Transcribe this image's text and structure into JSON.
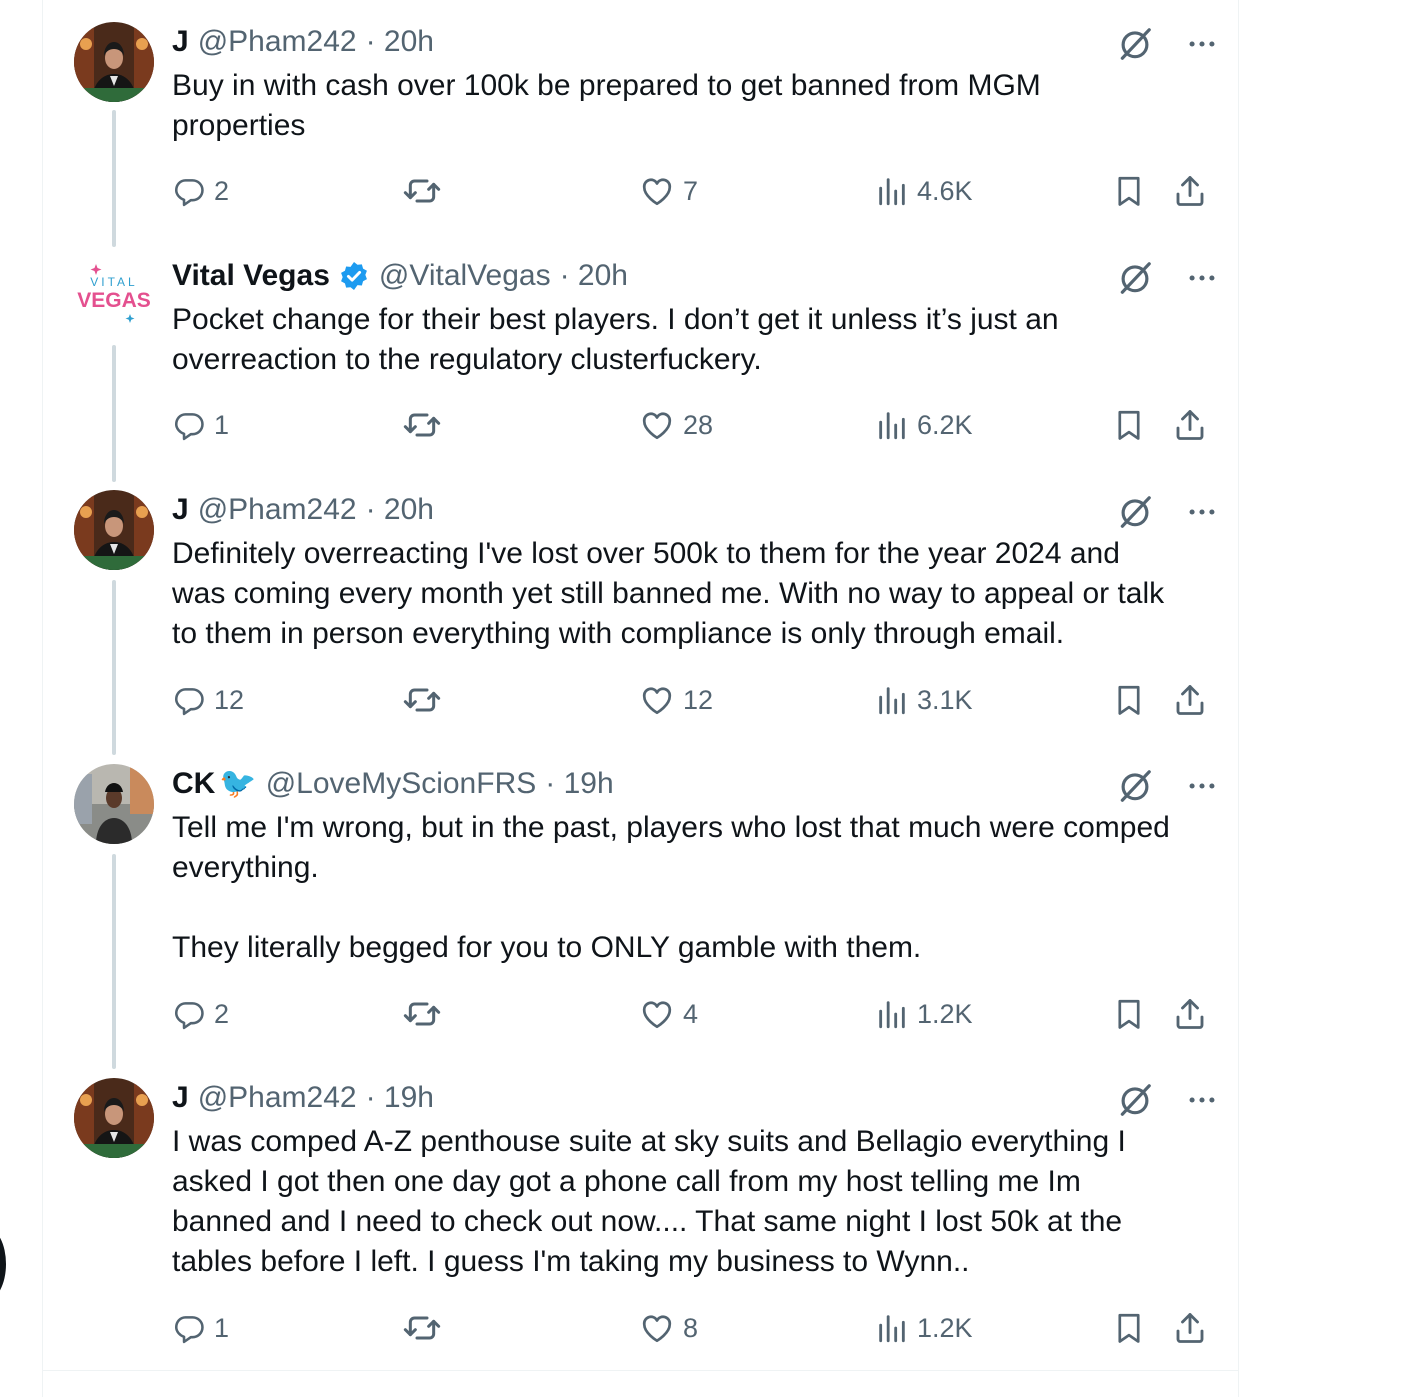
{
  "tweets": [
    {
      "name": "J",
      "handle": "@Pham242",
      "time": "· 20h",
      "verified": false,
      "avatar": "suited-man-avatar",
      "text": "Buy in with cash over 100k be prepared to get banned from MGM\nproperties",
      "replies": "2",
      "retweets": "",
      "likes": "7",
      "views": "4.6K"
    },
    {
      "name": "Vital Vegas",
      "handle": "@VitalVegas",
      "time": "· 20h",
      "verified": true,
      "avatar": "vital-vegas-logo",
      "logo_text_top": "VITAL",
      "logo_text_bottom": "VEGAS",
      "text": "Pocket change for their best players. I don’t get it unless it’s just an\noverreaction to the regulatory clusterfuckery.",
      "replies": "1",
      "retweets": "",
      "likes": "28",
      "views": "6.2K"
    },
    {
      "name": "J",
      "handle": "@Pham242",
      "time": "· 20h",
      "verified": false,
      "avatar": "suited-man-avatar",
      "text": "Definitely overreacting I've lost over 500k to them for the year 2024 and\nwas coming every month yet still banned me. With no way to appeal or talk\nto them in person everything with compliance is only through email.",
      "replies": "12",
      "retweets": "",
      "likes": "12",
      "views": "3.1K"
    },
    {
      "name": "CK",
      "handle": "@LoveMyScionFRS",
      "time": "· 19h",
      "verified": false,
      "emoji": "🐦",
      "avatar": "person-photo-avatar",
      "text": "Tell me I'm wrong, but in the past, players who lost that much were comped\neverything.\n\nThey literally begged for you to ONLY gamble with them.",
      "replies": "2",
      "retweets": "",
      "likes": "4",
      "views": "1.2K"
    },
    {
      "name": "J",
      "handle": "@Pham242",
      "time": "· 19h",
      "verified": false,
      "avatar": "suited-man-avatar",
      "text": "I was comped A-Z penthouse suite at sky suits and Bellagio everything I\nasked I got then one day got a phone call from my host telling me Im\nbanned and I need to check out now.... That same night I lost 50k at the\ntables  before I left. I guess I'm taking my business to Wynn..",
      "replies": "1",
      "retweets": "",
      "likes": "8",
      "views": "1.2K"
    }
  ],
  "colors": {
    "text": "#0f1419",
    "secondary": "#536471",
    "verified": "#1d9bf0",
    "thread_line": "#cfd9de",
    "divider": "#eff3f4"
  }
}
